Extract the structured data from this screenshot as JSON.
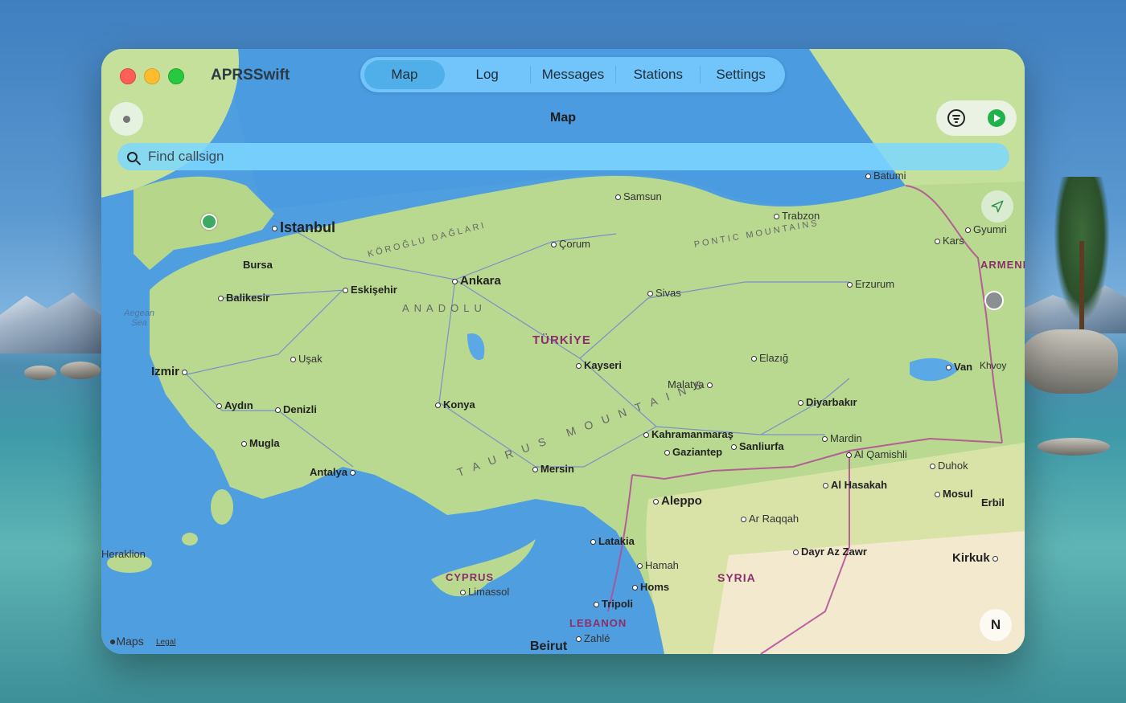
{
  "window": {
    "app_title": "APRSSwift",
    "section_title": "Map"
  },
  "tabs": [
    {
      "label": "Map",
      "active": true
    },
    {
      "label": "Log",
      "active": false
    },
    {
      "label": "Messages",
      "active": false
    },
    {
      "label": "Stations",
      "active": false
    },
    {
      "label": "Settings",
      "active": false
    }
  ],
  "search": {
    "placeholder": "Find callsign",
    "value": ""
  },
  "map": {
    "attribution": "Maps",
    "legal": "Legal",
    "compass": "N",
    "labels": {
      "istanbul": "Istanbul",
      "ankara": "Ankara",
      "izmir": "Izmir",
      "bursa": "Bursa",
      "eskisehir": "Eskişehir",
      "balikesir": "Balikesir",
      "usak": "Uşak",
      "aydin": "Aydın",
      "denizli": "Denizli",
      "mugla": "Mugla",
      "antalya": "Antalya",
      "konya": "Konya",
      "mersin": "Mersin",
      "kayseri": "Kayseri",
      "sivas": "Sivas",
      "corum": "Çorum",
      "samsun": "Samsun",
      "trabzon": "Trabzon",
      "batumi": "Batumi",
      "kars": "Kars",
      "gyumri": "Gyumri",
      "erzurum": "Erzurum",
      "elazig": "Elazığ",
      "malatya": "Malatya",
      "van": "Van",
      "khvoy": "Khvoy",
      "diyarbakir": "Diyarbakır",
      "mardin": "Mardin",
      "kahramanmaras": "Kahramanmaraş",
      "gaziantep": "Gaziantep",
      "sanliurfa": "Sanliurfa",
      "al_qamishli": "Al Qamishli",
      "duhok": "Duhok",
      "al_hasakah": "Al Hasakah",
      "mosul": "Mosul",
      "erbil": "Erbil",
      "kirkuk": "Kirkuk",
      "aleppo": "Aleppo",
      "ar_raqqah": "Ar Raqqah",
      "dayr_az_zawr": "Dayr Az Zawr",
      "latakia": "Latakia",
      "hamah": "Hamah",
      "homs": "Homs",
      "tripoli": "Tripoli",
      "zahle": "Zahlé",
      "beirut": "Beirut",
      "limassol": "Limassol",
      "heraklion": "Heraklion",
      "turkiye": "TÜRKİYE",
      "syria": "SYRIA",
      "cyprus": "CYPRUS",
      "lebanon": "LEBANON",
      "armenia": "ARMENI",
      "anadolu": "ANADOLU",
      "koroglu": "KÖROĞLU DAĞLARI",
      "pontic": "PONTIC MOUNTAINS",
      "taurus": "TAURUS MOUNTAINS",
      "aegean": "Aegean Sea"
    }
  },
  "colors": {
    "tab_bar": "#78cdff",
    "tab_active": "#46a5e1",
    "search_bar": "#7dd7ff",
    "land": "#b8d98f",
    "sea": "#4f9ee0",
    "station": "#3daa62",
    "play": "#22b24c"
  }
}
